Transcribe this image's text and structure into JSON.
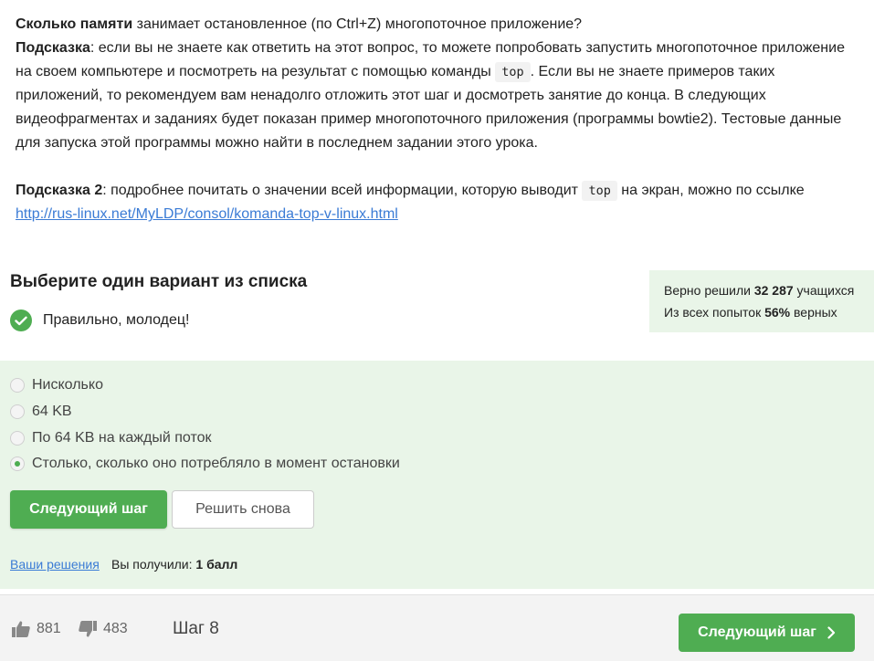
{
  "question": {
    "line1_bold": "Сколько памяти",
    "line1_rest": " занимает остановленное (по Ctrl+Z) многопоточное приложение?",
    "hint1_label": "Подсказка",
    "hint1_text_a": ": если вы не знаете как ответить на этот вопрос, то можете попробовать запустить многопоточное приложение на своем компьютере и посмотреть на результат с помощью команды ",
    "hint1_code": "top",
    "hint1_text_b": ". Если вы не знаете примеров таких приложений, то рекомендуем вам ненадолго отложить этот шаг и досмотреть занятие до конца. В следующих видеофрагментах и заданиях будет показан пример многопоточного приложения (программы bowtie2). Тестовые данные для запуска этой программы можно найти в последнем задании этого урока.",
    "hint2_label": "Подсказка 2",
    "hint2_text_a": ": подробнее почитать о значении всей информации, которую выводит ",
    "hint2_code": "top",
    "hint2_text_b": " на экран, можно по ссылке",
    "hint2_link": "http://rus-linux.net/MyLDP/consol/komanda-top-v-linux.html"
  },
  "quiz": {
    "heading": "Выберите один вариант из списка",
    "feedback": "Правильно, молодец!",
    "options": [
      "Нисколько",
      "64 KB",
      "По 64 KB на каждый поток",
      "Столько, сколько оно потребляло в момент остановки"
    ],
    "selected_index": 3,
    "next_button": "Следующий шаг",
    "retry_button": "Решить снова",
    "solutions_link": "Ваши решения",
    "score_label": "Вы получили: ",
    "score_value": "1 балл"
  },
  "stats": {
    "solved_prefix": "Верно решили ",
    "solved_count": "32 287",
    "solved_suffix": " учащихся",
    "attempts_prefix": "Из всех попыток ",
    "attempts_percent": "56%",
    "attempts_suffix": " верных"
  },
  "footer": {
    "likes": "881",
    "dislikes": "483",
    "step": "Шаг 8",
    "next_button": "Следующий шаг"
  },
  "colors": {
    "accent_green": "#4fad52",
    "panel_green": "#e9f5e8",
    "link_blue": "#3a7bd5"
  }
}
